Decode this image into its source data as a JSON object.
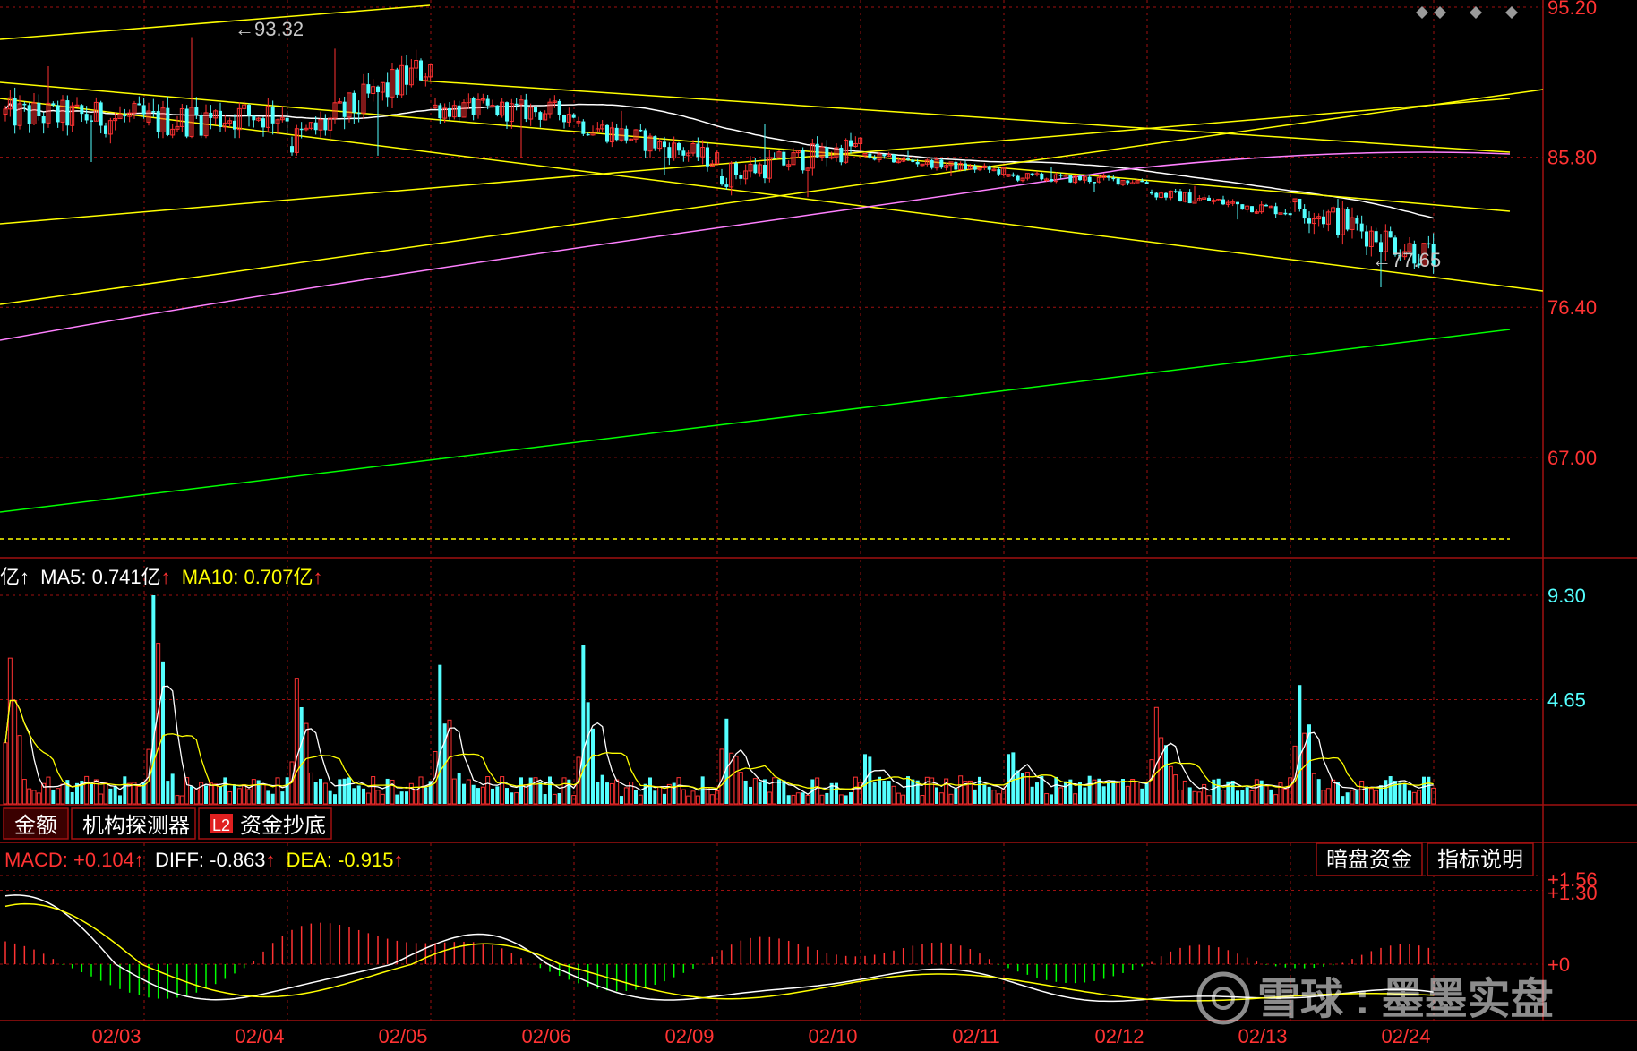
{
  "colors": {
    "background": "#000000",
    "up": "#ff3232",
    "down": "#54ffff",
    "grid_red": "#a01010",
    "price_label": "#ff3333",
    "volume_axis_label": "#54ffff",
    "ma_white": "#ffffff",
    "ma_yellow": "#ffff00",
    "ma_magenta": "#ff80ff",
    "ma_green": "#00ff00",
    "macd_neg": "#00ff00",
    "watermark": "#ffffff"
  },
  "toolbar_icons": [
    "diamond-icon",
    "diamond-icon",
    "diamond-icon",
    "diamond-icon"
  ],
  "price_panel": {
    "y_ticks": [
      "95.20",
      "85.80",
      "76.40",
      "67.00"
    ],
    "high_label": "93.32",
    "low_label": "77.65"
  },
  "volume_panel": {
    "legend_prefix": "亿↑",
    "ma5_label": "MA5: 0.741亿",
    "ma10_label": "MA10: 0.707亿",
    "arrow": "↑",
    "y_ticks": [
      "9.30",
      "4.65"
    ]
  },
  "tabs": [
    {
      "label": "金额",
      "active": true,
      "badge": ""
    },
    {
      "label": "机构探测器",
      "active": false,
      "badge": ""
    },
    {
      "label": "资金抄底",
      "active": false,
      "badge": "L2"
    }
  ],
  "macd_panel": {
    "macd_label": "MACD: +0.104",
    "diff_label": "DIFF: -0.863",
    "dea_label": "DEA: -0.915",
    "arrow": "↑",
    "buttons": [
      "暗盘资金",
      "指标说明"
    ],
    "y_ticks": [
      "+1.56",
      "+1.30",
      "+0"
    ]
  },
  "x_axis": {
    "dates": [
      "02/03",
      "02/04",
      "02/05",
      "02/06",
      "02/09",
      "02/10",
      "02/11",
      "02/12",
      "02/13",
      "02/24"
    ]
  },
  "watermark": {
    "text": "雪球 : 墨墨实盘"
  },
  "chart_data": {
    "type": "candlestick",
    "x": [
      "02/03",
      "02/04",
      "02/05",
      "02/06",
      "02/09",
      "02/10",
      "02/11",
      "02/12",
      "02/13",
      "02/24"
    ],
    "price_range": [
      62.0,
      95.2
    ],
    "ohlc_daily": [
      {
        "date": "02/03",
        "open": 88.5,
        "high": 91.5,
        "low": 85.5,
        "close": 88.2
      },
      {
        "date": "02/04",
        "open": 88.0,
        "high": 93.32,
        "low": 87.0,
        "close": 88.6
      },
      {
        "date": "02/05",
        "open": 86.5,
        "high": 92.6,
        "low": 85.9,
        "close": 91.6
      },
      {
        "date": "02/06",
        "open": 88.9,
        "high": 89.8,
        "low": 85.8,
        "close": 88.6
      },
      {
        "date": "02/09",
        "open": 88.0,
        "high": 88.7,
        "low": 84.7,
        "close": 85.6
      },
      {
        "date": "02/10",
        "open": 84.6,
        "high": 87.9,
        "low": 83.3,
        "close": 86.5
      },
      {
        "date": "02/11",
        "open": 85.9,
        "high": 86.2,
        "low": 84.6,
        "close": 84.9
      },
      {
        "date": "02/12",
        "open": 84.6,
        "high": 85.2,
        "low": 83.6,
        "close": 84.3
      },
      {
        "date": "02/13",
        "open": 83.6,
        "high": 84.0,
        "low": 81.9,
        "close": 82.4
      },
      {
        "date": "02/24",
        "open": 83.0,
        "high": 83.2,
        "low": 77.65,
        "close": 79.5
      }
    ],
    "volume_range": [
      0,
      9.3
    ],
    "volume_daily_peak": [
      {
        "date": "02/03",
        "value": 6.5,
        "direction": "up"
      },
      {
        "date": "02/04",
        "value": 9.3,
        "direction": "down"
      },
      {
        "date": "02/05",
        "value": 5.6,
        "direction": "up"
      },
      {
        "date": "02/06",
        "value": 6.2,
        "direction": "down"
      },
      {
        "date": "02/09",
        "value": 7.1,
        "direction": "down"
      },
      {
        "date": "02/10",
        "value": 3.8,
        "direction": "down"
      },
      {
        "date": "02/11",
        "value": 2.1,
        "direction": "down"
      },
      {
        "date": "02/12",
        "value": 2.3,
        "direction": "down"
      },
      {
        "date": "02/13",
        "value": 4.3,
        "direction": "up"
      },
      {
        "date": "02/24",
        "value": 5.3,
        "direction": "down"
      }
    ],
    "volume_ma": {
      "MA5": 0.741,
      "MA10": 0.707
    },
    "macd_range": [
      -1.9,
      1.56
    ],
    "macd_last": {
      "MACD": 0.104,
      "DIFF": -0.863,
      "DEA": -0.915
    }
  }
}
